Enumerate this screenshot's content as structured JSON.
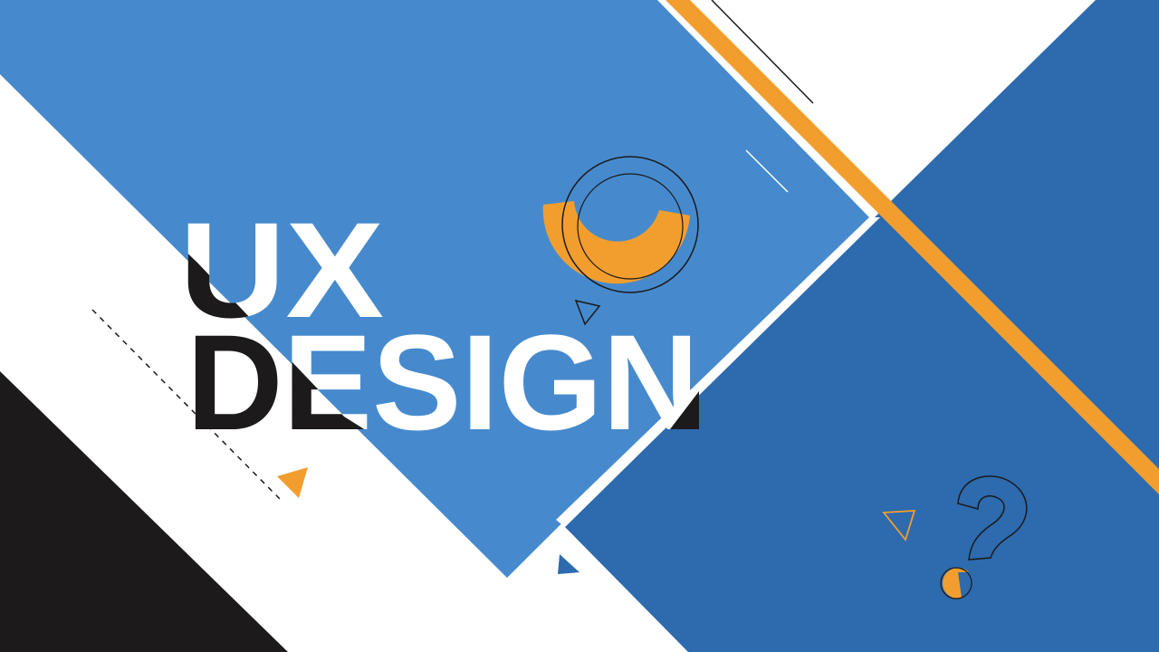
{
  "headline": {
    "line1": "UX",
    "line2": "DESIGN"
  },
  "colors": {
    "background": "#ffffff",
    "light_blue": "#468ACD",
    "dark_blue": "#2D6AAE",
    "orange": "#F29E2E",
    "black": "#1C1A1B",
    "white": "#ffffff",
    "outline": "#1a1a1a"
  },
  "decorations": {
    "question_mark": "?",
    "icon_names": [
      "ring-outline-icon",
      "orange-arc-icon",
      "question-mark-icon",
      "small-triangle-icon",
      "dashed-line",
      "orange-stripe"
    ]
  }
}
